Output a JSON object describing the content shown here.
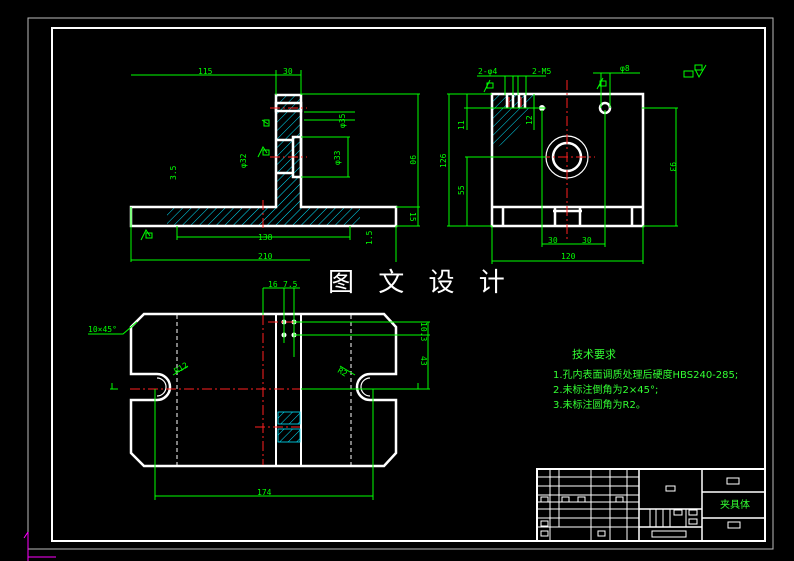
{
  "drawing_title": "图 文 设 计",
  "front_view": {
    "dims": [
      "115",
      "30",
      "90",
      "15",
      "138",
      "210",
      "3.5",
      "φ33",
      "φ35",
      "φ32",
      "1.5"
    ]
  },
  "side_view": {
    "dims": [
      "2-φ4",
      "2-M5",
      "φ8",
      "12",
      "11",
      "126",
      "55",
      "93",
      "30",
      "30",
      "120"
    ]
  },
  "top_view": {
    "dims": [
      "16",
      "7.5",
      "10×45°",
      "R12",
      "R2",
      "10.3",
      "43",
      "174"
    ]
  },
  "tech_requirements": {
    "heading": "技术要求",
    "items": [
      "1.孔内表面调质处理后硬度HBS240-285;",
      "2.未标注倒角为2×45°;",
      "3.未标注圆角为R2。"
    ]
  },
  "title_block": {
    "part_name": "夹具体"
  },
  "colors": {
    "outline": "#ffffff",
    "dimension": "#00ff00",
    "centerline": "#ff2020",
    "hatch": "#00ffff"
  }
}
